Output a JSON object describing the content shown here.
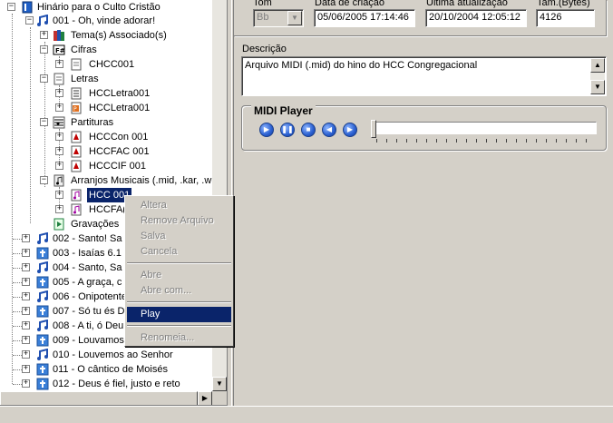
{
  "tree": {
    "root_label": "Hinário para o Culto Cristão",
    "hymn_001": "001 - Oh, vinde adorar!",
    "temas": "Tema(s) Associado(s)",
    "cifras": "Cifras",
    "cifra_file": "CHCC001",
    "letras": "Letras",
    "letra_file_1": "HCCLetra001",
    "letra_file_2": "HCCLetra001",
    "partituras": "Partituras",
    "partitura_1": "HCCCon 001",
    "partitura_2": "HCCFAC 001",
    "partitura_3": "HCCCIF 001",
    "arranjos": "Arranjos Musicais (.mid, .kar, .wrk",
    "arranjo_1": "HCC 001",
    "arranjo_2": "HCCFA(",
    "gravacoes": "Gravações",
    "hymns": [
      {
        "label": "002 - Santo! Sa",
        "icon": "music-note-icon"
      },
      {
        "label": "003 - Isaías 6.1",
        "icon": "cross-icon"
      },
      {
        "label": "004 - Santo, Sa",
        "icon": "music-note-icon"
      },
      {
        "label": "005 - A graça, c",
        "icon": "cross-icon"
      },
      {
        "label": "006 - Onipotente",
        "icon": "music-note-icon"
      },
      {
        "label": "007 - Só tu és D",
        "icon": "cross-icon"
      },
      {
        "label": "008 - A ti, ó Deu",
        "icon": "music-note-icon"
      },
      {
        "label": "009 - Louvamos",
        "icon": "cross-icon"
      },
      {
        "label": "010 - Louvemos ao Senhor",
        "icon": "music-note-icon"
      },
      {
        "label": "011 - O cântico de Moisés",
        "icon": "cross-icon"
      },
      {
        "label": "012 - Deus é fiel, justo e reto",
        "icon": "cross-icon"
      }
    ]
  },
  "fields": {
    "tom_label": "Tom",
    "tom_value": "Bb",
    "data_criacao_label": "Data de criação",
    "data_criacao_value": "05/06/2005 17:14:46",
    "ultima_atualizacao_label": "Última atualização",
    "ultima_atualizacao_value": "20/10/2004 12:05:12",
    "tamanho_label": "Tam.(Bytes)",
    "tamanho_value": "4126",
    "descricao_label": "Descrição",
    "descricao_value": "Arquivo MIDI (.mid) do hino do HCC Congregacional"
  },
  "midi_player": {
    "title": "MIDI Player",
    "progress": 0
  },
  "context_menu": {
    "items": [
      {
        "label": "Altera",
        "enabled": false
      },
      {
        "label": "Remove Arquivo",
        "enabled": false
      },
      {
        "label": "Salva",
        "enabled": false
      },
      {
        "label": "Cancela",
        "enabled": false
      },
      {
        "label": "Abre",
        "enabled": false
      },
      {
        "label": "Abre com...",
        "enabled": false
      },
      {
        "label": "Play",
        "enabled": true,
        "highlighted": true
      },
      {
        "label": "Renomeia...",
        "enabled": false
      }
    ]
  },
  "colors": {
    "window_bg": "#d4d0c8",
    "selection": "#0a246a",
    "player_button": "#2a5fd0"
  }
}
